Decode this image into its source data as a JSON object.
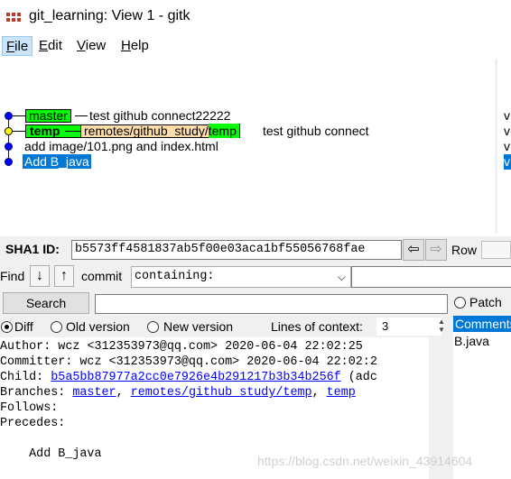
{
  "window": {
    "title": "git_learning: View 1 - gitk"
  },
  "menu": [
    {
      "label": "File",
      "mnemonic": "F",
      "rest": "ile"
    },
    {
      "label": "Edit",
      "mnemonic": "E",
      "rest": "dit"
    },
    {
      "label": "View",
      "mnemonic": "V",
      "rest": "iew"
    },
    {
      "label": "Help",
      "mnemonic": "H",
      "rest": "elp"
    }
  ],
  "commits": [
    {
      "refs": [
        "master"
      ],
      "summary": "test github connect22222"
    },
    {
      "refs": [
        "temp",
        "remotes/github_study/temp"
      ],
      "summary": "test github connect"
    },
    {
      "refs": [],
      "summary": "add image/101.png and index.html"
    },
    {
      "refs": [],
      "summary": "Add B_java"
    }
  ],
  "author_col": [
    "v",
    "v",
    "v",
    "v"
  ],
  "sha": {
    "label": "SHA1 ID:",
    "value": "b5573ff4581837ab5f00e03aca1bf55056768fae",
    "row_label": "Row"
  },
  "find": {
    "label": "Find",
    "commit_label": "commit",
    "mode": "containing:"
  },
  "search": {
    "button_label": "Search",
    "patch_label": "Patch"
  },
  "diff_options": {
    "diff_label": "Diff",
    "old_label": "Old version",
    "new_label": "New version",
    "context_label": "Lines of context:",
    "context_value": "3"
  },
  "details": {
    "author": "Author: wcz <312353973@qq.com>  2020-06-04 22:02:25",
    "committer": "Committer: wcz <312353973@qq.com>  2020-06-04 22:02:2",
    "child_label": "Child:  ",
    "child_sha": "b5a5bb87977a2cc0e7926e4b291217b3b34b256f",
    "child_tail": " (adc",
    "branches_label": "Branches: ",
    "branches": [
      "master",
      "remotes/github_study/temp",
      "temp"
    ],
    "follows": "Follows:",
    "precedes": "Precedes:",
    "message": "    Add B_java"
  },
  "files": {
    "header": "Comments",
    "items": [
      "B.java"
    ]
  },
  "watermark": "https://blog.csdn.net/weixin_43914604",
  "colors": {
    "head_ref": "#00ff00",
    "remote_ref": "#ffddaa",
    "selection": "#0078d7",
    "graph": "#0000ff"
  }
}
